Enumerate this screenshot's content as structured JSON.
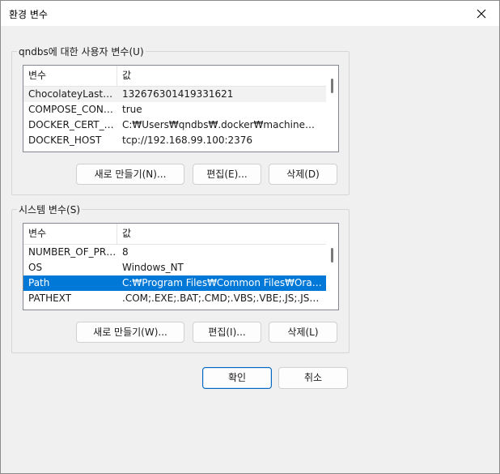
{
  "window": {
    "title": "환경 변수"
  },
  "user_group": {
    "label": "qndbs에 대한 사용자 변수(U)",
    "columns": [
      "변수",
      "값"
    ],
    "rows": [
      {
        "name": "ChocolateyLastPat...",
        "value": "132676301419331621"
      },
      {
        "name": "COMPOSE_CONV...",
        "value": "true"
      },
      {
        "name": "DOCKER_CERT_PA...",
        "value": "C:₩Users₩qndbs₩.docker₩machine₩mach..."
      },
      {
        "name": "DOCKER_HOST",
        "value": "tcp://192.168.99.100:2376"
      }
    ],
    "buttons": {
      "new": "새로 만들기(N)...",
      "edit": "편집(E)...",
      "delete": "삭제(D)"
    }
  },
  "system_group": {
    "label": "시스템 변수(S)",
    "columns": [
      "변수",
      "값"
    ],
    "rows": [
      {
        "name": "NUMBER_OF_PRO...",
        "value": "8"
      },
      {
        "name": "OS",
        "value": "Windows_NT"
      },
      {
        "name": "Path",
        "value": "C:₩Program Files₩Common Files₩Oracle₩..."
      },
      {
        "name": "PATHEXT",
        "value": ".COM;.EXE;.BAT;.CMD;.VBS;.VBE;.JS;.JSE;.W..."
      }
    ],
    "selected_row": "Path",
    "buttons": {
      "new": "새로 만들기(W)...",
      "edit": "편집(I)...",
      "delete": "삭제(L)"
    }
  },
  "footer": {
    "ok": "확인",
    "cancel": "취소"
  },
  "colors": {
    "selection": "#0078d7",
    "primary_border": "#0067c0"
  }
}
